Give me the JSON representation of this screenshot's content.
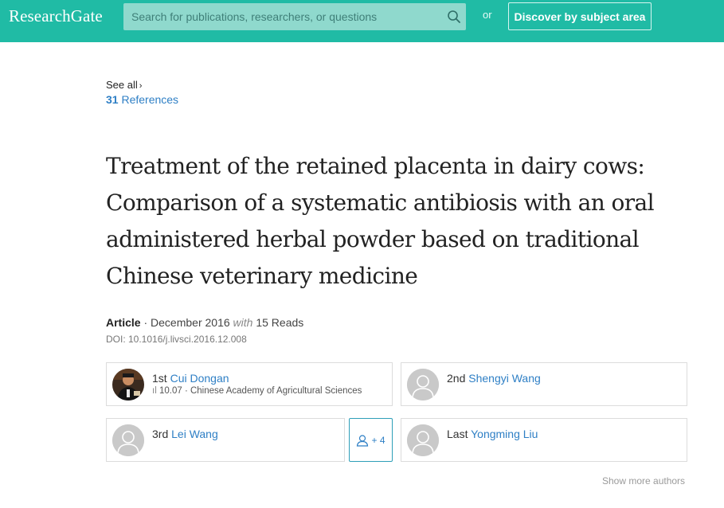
{
  "header": {
    "logo": "ResearchGate",
    "search_placeholder": "Search for publications, researchers, or questions",
    "or_label": "or",
    "discover_label": "Discover by subject area"
  },
  "references": {
    "see_all": "See all",
    "see_all_chevron": "›",
    "count": "31",
    "label": "References"
  },
  "article": {
    "title_lines": [
      "Treatment of the retained placenta in dairy cows:",
      "Comparison of a systematic antibiosis with an oral",
      "administered herbal powder based on traditional",
      "Chinese veterinary medicine"
    ],
    "type": "Article",
    "date_sep": "·",
    "date": "December 2016",
    "with": "with",
    "reads": "15 Reads",
    "doi": "DOI: 10.1016/j.livsci.2016.12.008"
  },
  "authors": [
    {
      "order": "1st",
      "name": "Cui Dongan",
      "score_icon": "ıl",
      "score": "10.07",
      "affiliation": "Chinese Academy of Agricultural Sciences"
    },
    {
      "order": "2nd",
      "name": "Shengyi Wang"
    },
    {
      "order": "3rd",
      "name": "Lei Wang"
    },
    {
      "order": "Last",
      "name": "Yongming Liu"
    }
  ],
  "more_authors": {
    "count_label": "+ 4",
    "show_more": "Show more authors"
  },
  "colors": {
    "brand": "#20bba5",
    "link": "#2e7fc5"
  }
}
